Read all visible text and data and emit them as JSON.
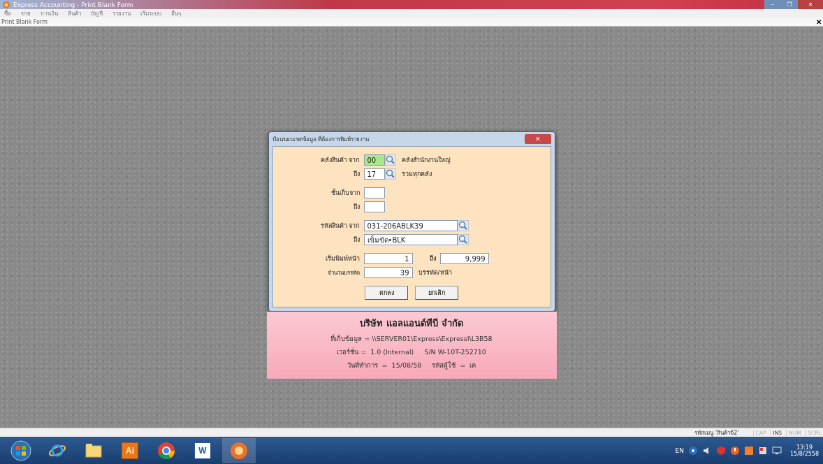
{
  "window": {
    "title": "Express Accounting - Print Blank Form",
    "controls": [
      "–",
      "❐",
      "✕"
    ]
  },
  "menu": [
    "ซื้อ",
    "ขาย",
    "การเงิน",
    "สินค้า",
    "บัญชี",
    "รายงาน",
    "เริ่มระบบ",
    "อื่นๆ"
  ],
  "child_window": {
    "title": "Print Blank Form",
    "close": "✕"
  },
  "dialog": {
    "title": "ป้อนขอบเขตข้อมูล ที่ต้องการพิมพ์รายงาน",
    "close": "✕",
    "rows": [
      {
        "kind": "lookup",
        "label": "คลังสินค้า จาก",
        "value": "00",
        "focused": true,
        "note": "คลังสำนักงานใหญ่"
      },
      {
        "kind": "lookup",
        "label": "ถึง",
        "value": "17",
        "focused": false,
        "note": "รวมทุกคลัง"
      },
      {
        "kind": "gap"
      },
      {
        "kind": "field",
        "label": "ชั้นเก็บจาก",
        "value": "",
        "focused": false
      },
      {
        "kind": "field",
        "label": "ถึง",
        "value": "",
        "focused": false
      },
      {
        "kind": "gap"
      },
      {
        "kind": "longlookup",
        "label": "รหัสสินค้า จาก",
        "value": "031-206ABLK39",
        "focused": false
      },
      {
        "kind": "longlookup",
        "label": "ถึง",
        "value": "เข็มขัด•BLK",
        "focused": false
      },
      {
        "kind": "gap"
      },
      {
        "kind": "range",
        "label": "เริ่มพิมพ์หน้า",
        "value": "1",
        "focused": false,
        "to_label": "ถึง",
        "to_value": "9,999"
      },
      {
        "kind": "unit",
        "label": "จำนวนบรรทัด",
        "value": "39",
        "focused": false,
        "note": "บรรทัด/หน้า"
      }
    ],
    "buttons": [
      "ตกลง",
      "ยกเลิก"
    ]
  },
  "info_panel": {
    "company": "บริษัท แอลแอนด์ทีบี จำกัด",
    "lines": [
      "ที่เก็บข้อมูล = \\\\SERVER01\\Express\\ExpressI\\L3B58",
      "เวอร์ชั่น =  1.0 (Internal)     S/N W-10T-252710",
      "วันที่ทำการ  =  15/08/58     รหัสผู้ใช้  =  เค"
    ]
  },
  "status_bar": {
    "menu_code": "รหัสเมนู 'สินค้า62'",
    "keys": [
      {
        "label": "CAP",
        "on": false
      },
      {
        "label": "INS",
        "on": true
      },
      {
        "label": "NUM",
        "on": false
      },
      {
        "label": "SCRL",
        "on": false
      }
    ]
  },
  "taskbar": {
    "apps": [
      {
        "kind": "start",
        "active": false
      },
      {
        "kind": "browser",
        "active": false
      },
      {
        "kind": "folder",
        "active": false
      },
      {
        "kind": "illustrator",
        "label": "Ai",
        "active": false
      },
      {
        "kind": "chrome",
        "active": false
      },
      {
        "kind": "word",
        "label": "W",
        "active": false
      },
      {
        "kind": "express",
        "active": true
      }
    ],
    "language": "EN",
    "time": "13:19",
    "date": "15/8/2558"
  }
}
